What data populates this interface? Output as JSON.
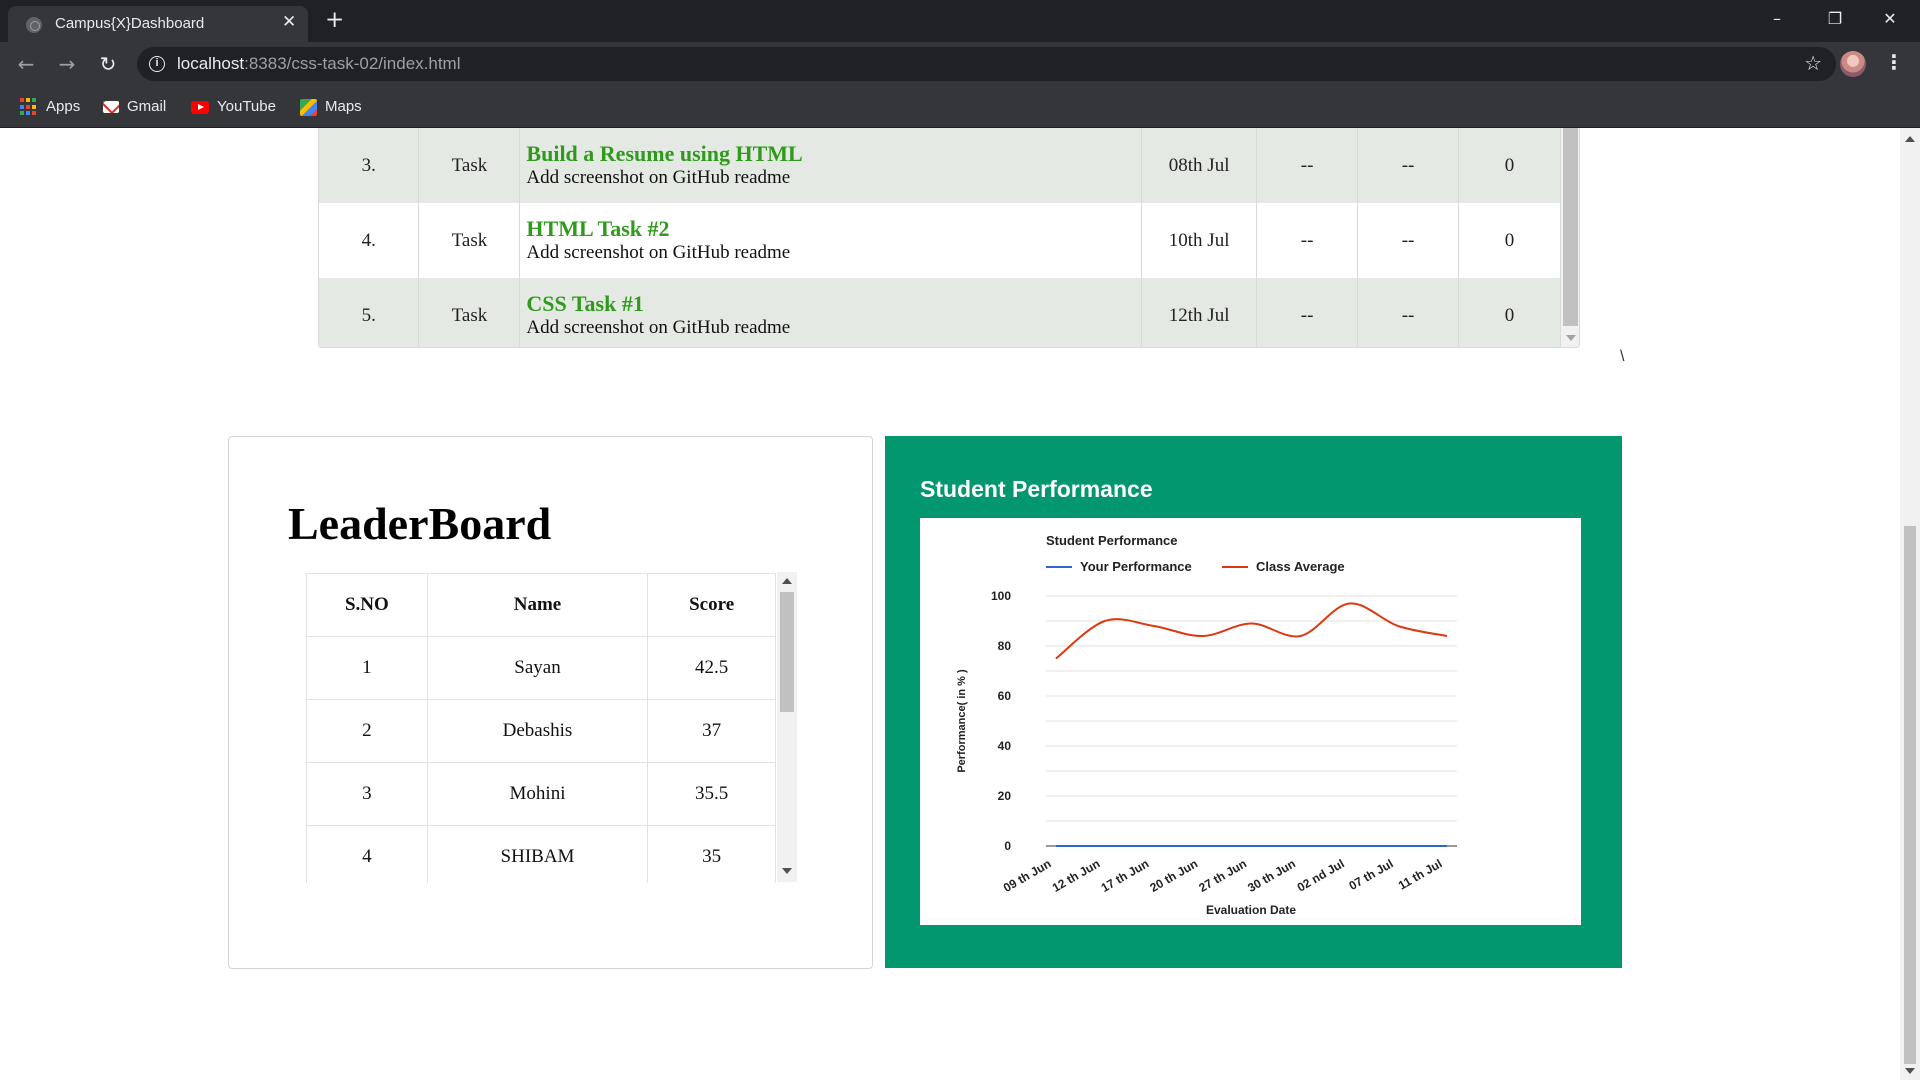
{
  "browser": {
    "tab_title": "Campus{X}Dashboard",
    "tab_close": "✕",
    "new_tab": "+",
    "url_host": "localhost",
    "url_path": ":8383/css-task-02/index.html",
    "bookmarks": [
      {
        "label": "Apps",
        "icon": "apps-grid-icon"
      },
      {
        "label": "Gmail",
        "icon": "gmail-icon"
      },
      {
        "label": "YouTube",
        "icon": "youtube-icon"
      },
      {
        "label": "Maps",
        "icon": "maps-icon"
      }
    ]
  },
  "tasks": {
    "rows": [
      {
        "no": "3.",
        "type": "Task",
        "title": "Build a Resume using HTML",
        "subtitle": "Add screenshot on GitHub readme",
        "date": "08th Jul",
        "c1": "--",
        "c2": "--",
        "score": "0"
      },
      {
        "no": "4.",
        "type": "Task",
        "title": "HTML Task #2",
        "subtitle": "Add screenshot on GitHub readme",
        "date": "10th Jul",
        "c1": "--",
        "c2": "--",
        "score": "0"
      },
      {
        "no": "5.",
        "type": "Task",
        "title": "CSS Task #1",
        "subtitle": "Add screenshot on GitHub readme",
        "date": "12th Jul",
        "c1": "--",
        "c2": "--",
        "score": "0"
      }
    ]
  },
  "stray_text": "\\",
  "leaderboard": {
    "title": "LeaderBoard",
    "headers": [
      "S.NO",
      "Name",
      "Score"
    ],
    "rows": [
      {
        "sno": "1",
        "name": "Sayan",
        "score": "42.5"
      },
      {
        "sno": "2",
        "name": "Debashis",
        "score": "37"
      },
      {
        "sno": "3",
        "name": "Mohini",
        "score": "35.5"
      },
      {
        "sno": "4",
        "name": "SHIBAM",
        "score": "35"
      }
    ]
  },
  "performance": {
    "card_title": "Student Performance",
    "colors": {
      "card_bg": "#039770",
      "your_performance": "#3366cc",
      "class_average": "#dc3912"
    }
  },
  "chart_data": {
    "type": "line",
    "title": "Student Performance",
    "xlabel": "Evaluation Date",
    "ylabel": "Performance( in % )",
    "ylim": [
      0,
      100
    ],
    "yticks": [
      0,
      20,
      40,
      60,
      80,
      100
    ],
    "grid": true,
    "legend_position": "top",
    "x": [
      "09 th Jun",
      "12 th Jun",
      "17 th Jun",
      "20 th Jun",
      "27 th Jun",
      "30 th Jun",
      "02 nd Jul",
      "07 th Jul",
      "11 th Jul"
    ],
    "series": [
      {
        "name": "Your Performance",
        "color": "#3366cc",
        "values": [
          0,
          0,
          0,
          0,
          0,
          0,
          0,
          0,
          0
        ]
      },
      {
        "name": "Class Average",
        "color": "#dc3912",
        "values": [
          75,
          90,
          88,
          84,
          89,
          84,
          97,
          88,
          84
        ]
      }
    ]
  }
}
